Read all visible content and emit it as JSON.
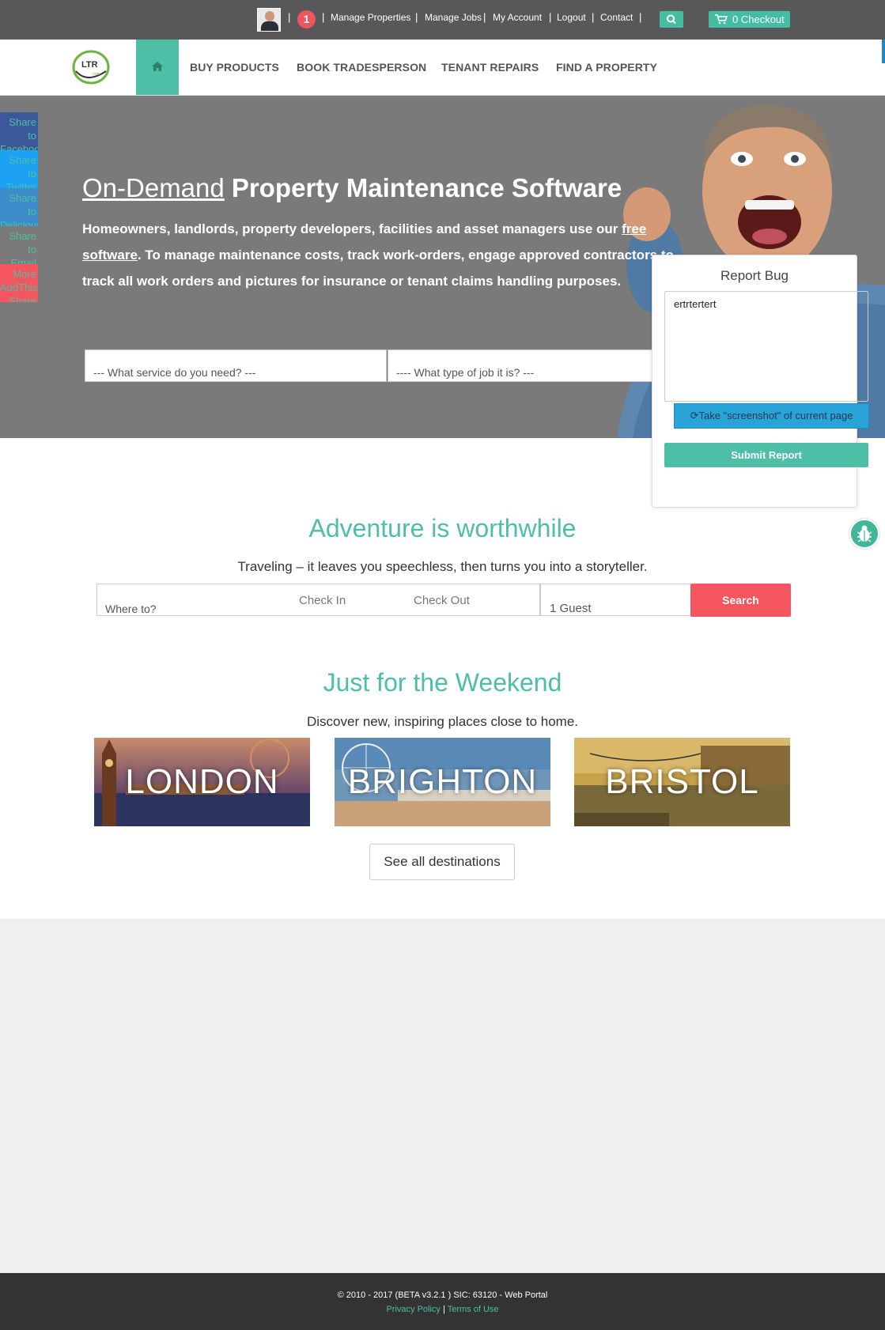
{
  "topbar": {
    "notifications": "1",
    "links": [
      "Manage Properties",
      "Manage Jobs",
      "My Account",
      "Logout",
      "Contact"
    ],
    "checkout": "0 Checkout"
  },
  "nav": {
    "items": [
      "BUY PRODUCTS",
      "BOOK TRADESPERSON",
      "TENANT REPAIRS",
      "FIND A PROPERTY"
    ]
  },
  "share": [
    {
      "label": "Share to Facebook",
      "color": "#3b5998"
    },
    {
      "label": "Share to Twitter",
      "color": "#1da1f2"
    },
    {
      "label": "Share to Delicious",
      "color": "#3d8cc9"
    },
    {
      "label": "Share to Email",
      "color": "#7a7a7a"
    },
    {
      "label": "More AddThis Share",
      "color": "#f5555f"
    }
  ],
  "hero": {
    "title_underline": "On-Demand",
    "title_rest": "Property Maintenance Software",
    "text_before_link": "Homeowners, landlords, property developers, facilities and asset managers use our ",
    "text_link": "free software",
    "text_after_link": ". To manage maintenance costs, track work-orders, engage approved contractors to track all work orders and pictures for insurance or tenant claims handling purposes.",
    "service_placeholder": "--- What service do you need? ---",
    "job_placeholder": "---- What type of job it is? ---"
  },
  "bug_report": {
    "title": "Report Bug",
    "text": "ertrtertert",
    "screenshot_button": "Take \"screenshot\" of current page",
    "submit": "Submit Report"
  },
  "adventure": {
    "title": "Adventure is worthwhile",
    "subtitle": "Traveling – it leaves you speechless, then turns you into a storyteller.",
    "where_placeholder": "Where to?",
    "check_in": "Check In",
    "check_out": "Check Out",
    "guests": "1 Guest",
    "search": "Search"
  },
  "weekend": {
    "title": "Just for the Weekend",
    "subtitle": "Discover new, inspiring places close to home.",
    "cities": [
      "LONDON",
      "BRIGHTON",
      "BRISTOL"
    ],
    "see_all": "See all destinations"
  },
  "footer": {
    "copyright": "© 2010 - 2017 (BETA v3.2.1 ) SIC: 63120 - Web Portal",
    "privacy": "Privacy Policy",
    "separator": "|",
    "terms": "Terms of Use"
  }
}
